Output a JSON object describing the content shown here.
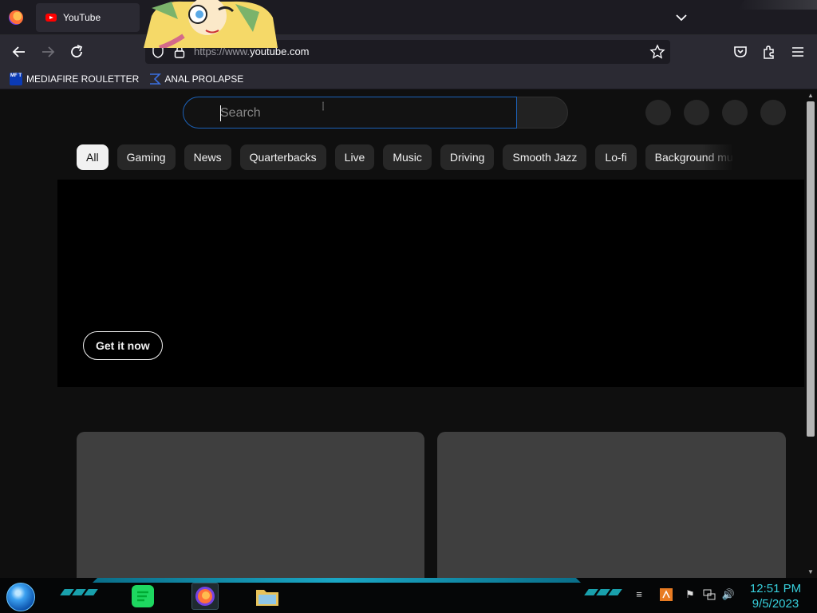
{
  "browser": {
    "tab_title": "YouTube",
    "url_prefix": "https://www.",
    "url_domain": "youtube.com",
    "bookmarks": [
      {
        "label": "MEDIAFIRE ROULETTER",
        "icon": "mft-icon",
        "icon_text": "MF T"
      },
      {
        "label": "ANAL PROLAPSE",
        "icon": "sigma-icon"
      }
    ]
  },
  "youtube": {
    "search_placeholder": "Search",
    "chips": [
      "All",
      "Gaming",
      "News",
      "Quarterbacks",
      "Live",
      "Music",
      "Driving",
      "Smooth Jazz",
      "Lo-fi",
      "Background music"
    ],
    "active_chip": "All",
    "banner_button": "Get it now"
  },
  "taskbar": {
    "time": "12:51 PM",
    "date": "9/5/2023"
  },
  "colors": {
    "accent_search_border": "#1c62b9",
    "page_bg": "#0f0f0f",
    "clock": "#37d0dd"
  }
}
